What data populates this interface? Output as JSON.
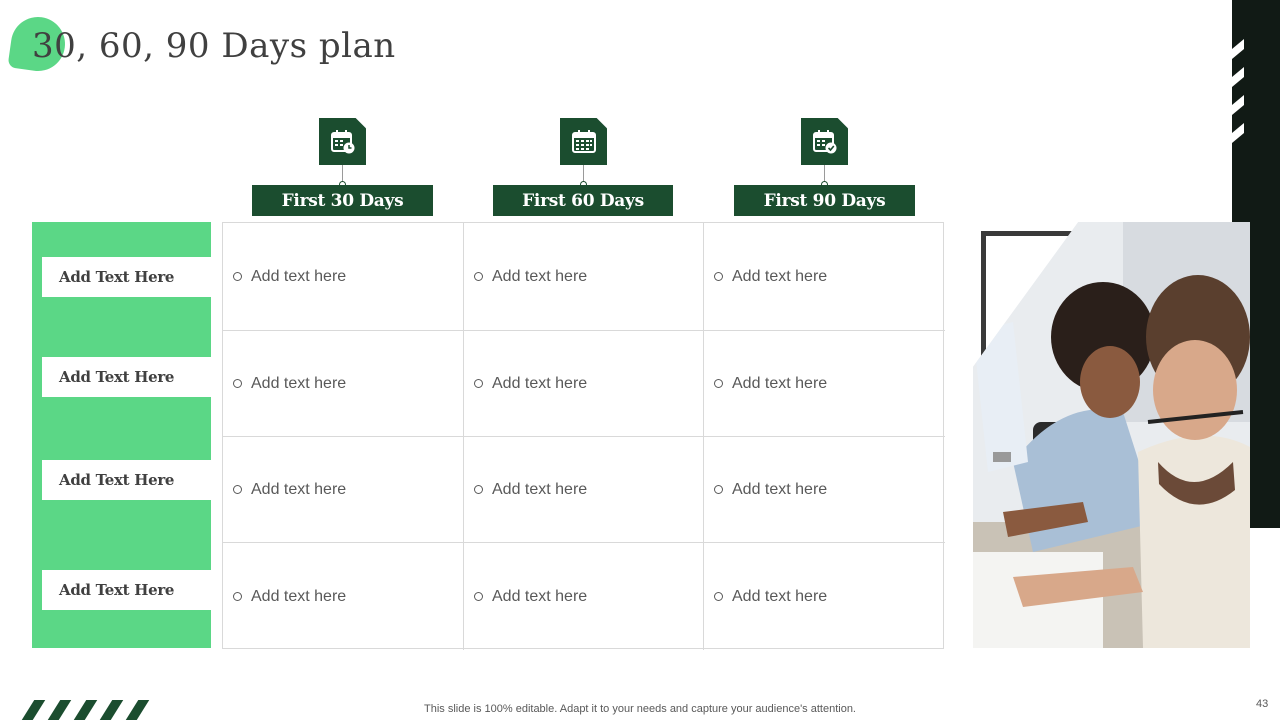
{
  "slide": {
    "title": "30, 60, 90 Days plan",
    "footer": "This slide is 100% editable. Adapt it to your needs and capture your audience's attention.",
    "page_number": "43"
  },
  "columns": [
    {
      "label": "First 30 Days",
      "icon": "calendar-clock-icon"
    },
    {
      "label": "First 60 Days",
      "icon": "calendar-grid-icon"
    },
    {
      "label": "First 90 Days",
      "icon": "calendar-check-icon"
    }
  ],
  "rows": [
    {
      "label": "Add Text Here",
      "cells": [
        "Add text here",
        "Add text here",
        "Add text here"
      ]
    },
    {
      "label": "Add Text Here",
      "cells": [
        "Add text here",
        "Add text here",
        "Add text here"
      ]
    },
    {
      "label": "Add Text Here",
      "cells": [
        "Add text here",
        "Add text here",
        "Add text here"
      ]
    },
    {
      "label": "Add Text Here",
      "cells": [
        "Add text here",
        "Add text here",
        "Add text here"
      ]
    }
  ],
  "colors": {
    "dark_green": "#1b4d2f",
    "light_green": "#5bd786",
    "dark_bar": "#111a15"
  }
}
